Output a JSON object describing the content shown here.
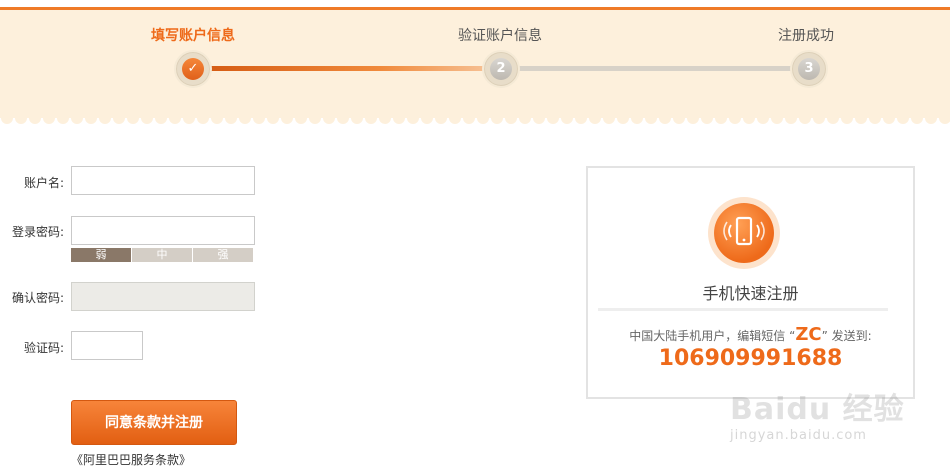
{
  "progress": {
    "steps": [
      {
        "label": "填写账户信息",
        "number": "",
        "status": "done"
      },
      {
        "label": "验证账户信息",
        "number": "2",
        "status": "pending"
      },
      {
        "label": "注册成功",
        "number": "3",
        "status": "pending"
      }
    ],
    "check_mark": "✓",
    "accent": "#ee6a1a"
  },
  "form": {
    "account_label": "账户名:",
    "password_label": "登录密码:",
    "strength": {
      "weak": "弱",
      "medium": "中",
      "strong": "强"
    },
    "confirm_label": "确认密码:",
    "captcha_label": "验证码:",
    "submit_label": "同意条款并注册",
    "terms_link": "《阿里巴巴服务条款》"
  },
  "mobile_card": {
    "icon": "mobile-phone-icon",
    "title": "手机快速注册",
    "desc_before": "中国大陆手机用户，编辑短信 “",
    "code": "ZC",
    "desc_after": "” 发送到:",
    "number": "106909991688"
  },
  "watermark": {
    "brand": "Baidu 经验",
    "url": "jingyan.baidu.com"
  }
}
